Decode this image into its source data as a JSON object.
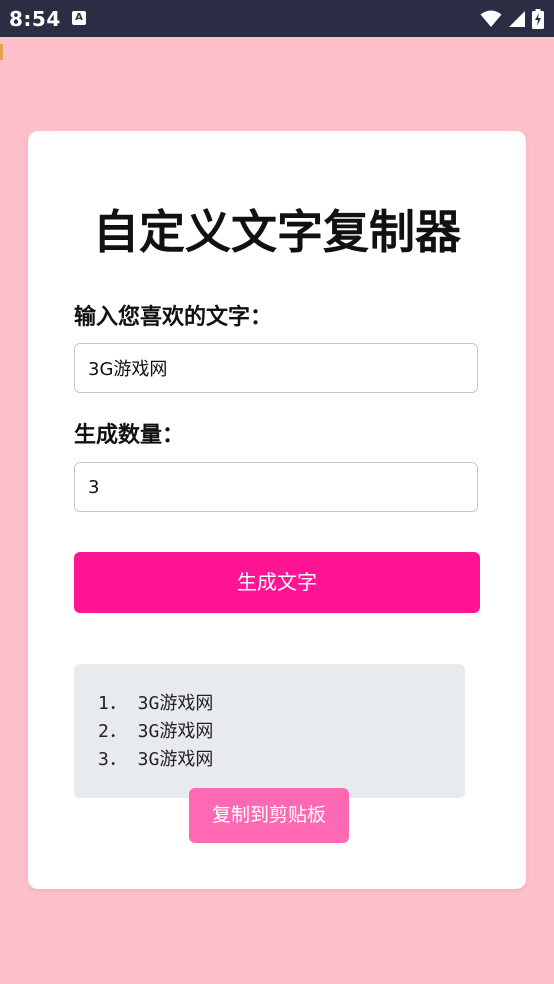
{
  "status_bar": {
    "time": "8:54",
    "app_icon_letter": "A",
    "icons": [
      "wifi-icon",
      "cellular-signal-icon",
      "battery-charging-icon"
    ]
  },
  "colors": {
    "page_background": "#ffc0cb",
    "card_background": "#ffffff",
    "primary_button": "#ff1493",
    "secondary_button": "#ff69b4",
    "result_background": "#e8ebee",
    "status_bar_background": "#2a2d44"
  },
  "app": {
    "title": "自定义文字复制器"
  },
  "form": {
    "text_label": "输入您喜欢的文字：",
    "text_value": "3G游戏网",
    "count_label": "生成数量：",
    "count_value": "3",
    "generate_button": "生成文字"
  },
  "results": {
    "items": [
      "1． 3G游戏网",
      "2． 3G游戏网",
      "3． 3G游戏网"
    ]
  },
  "actions": {
    "copy_button": "复制到剪贴板"
  }
}
